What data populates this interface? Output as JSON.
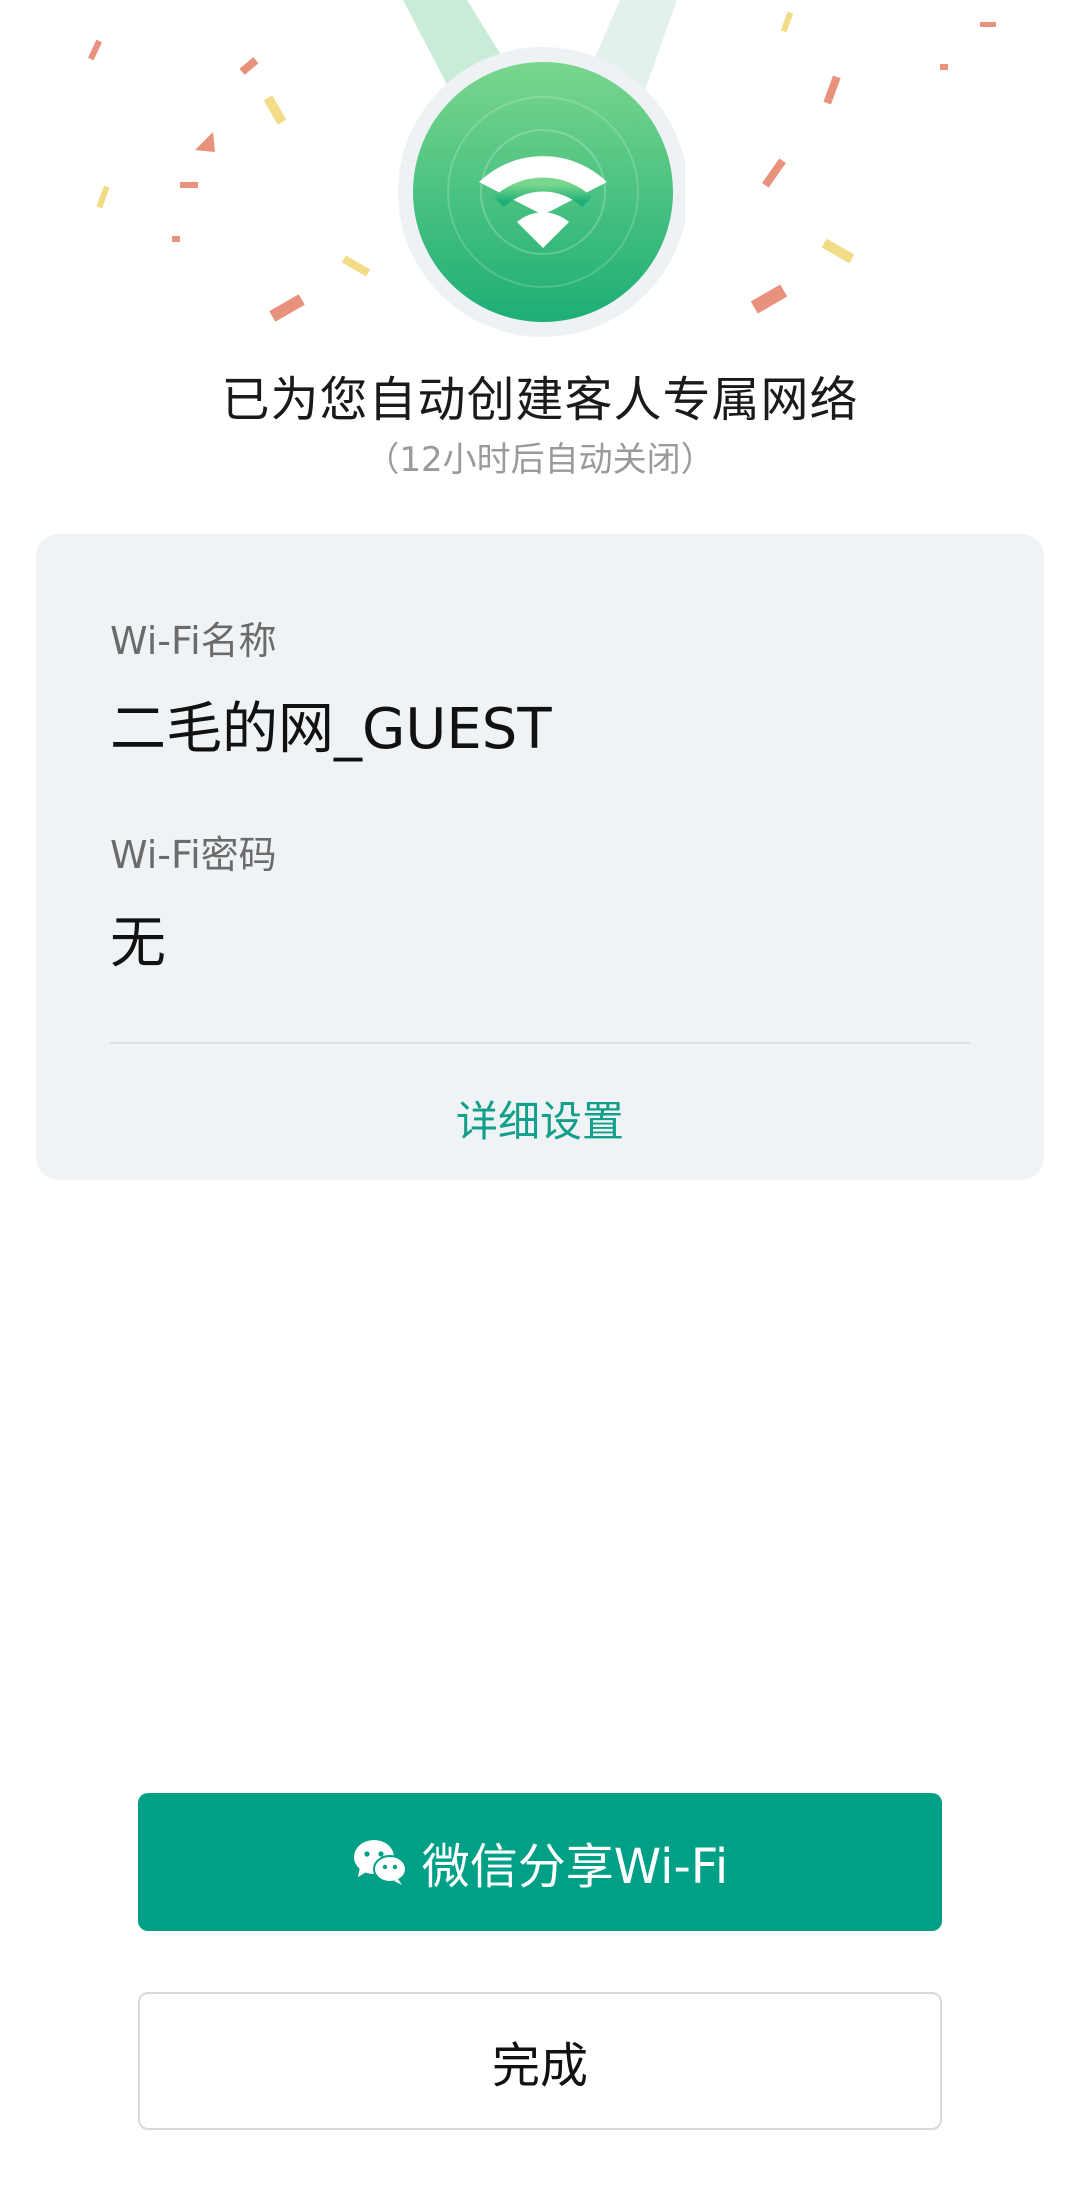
{
  "header": {
    "title": "已为您自动创建客人专属网络",
    "subtitle": "（12小时后自动关闭）",
    "medal_icon": "wifi-icon",
    "accent_color": "#2dbb7e"
  },
  "card": {
    "wifi_name_label": "Wi-Fi名称",
    "wifi_name_value": "二毛的网_GUEST",
    "wifi_password_label": "Wi-Fi密码",
    "wifi_password_value": "无",
    "detail_link": "详细设置",
    "link_color": "#12a08a"
  },
  "actions": {
    "share_label": "微信分享Wi-Fi",
    "share_icon": "wechat-icon",
    "share_color": "#00a086",
    "done_label": "完成"
  }
}
